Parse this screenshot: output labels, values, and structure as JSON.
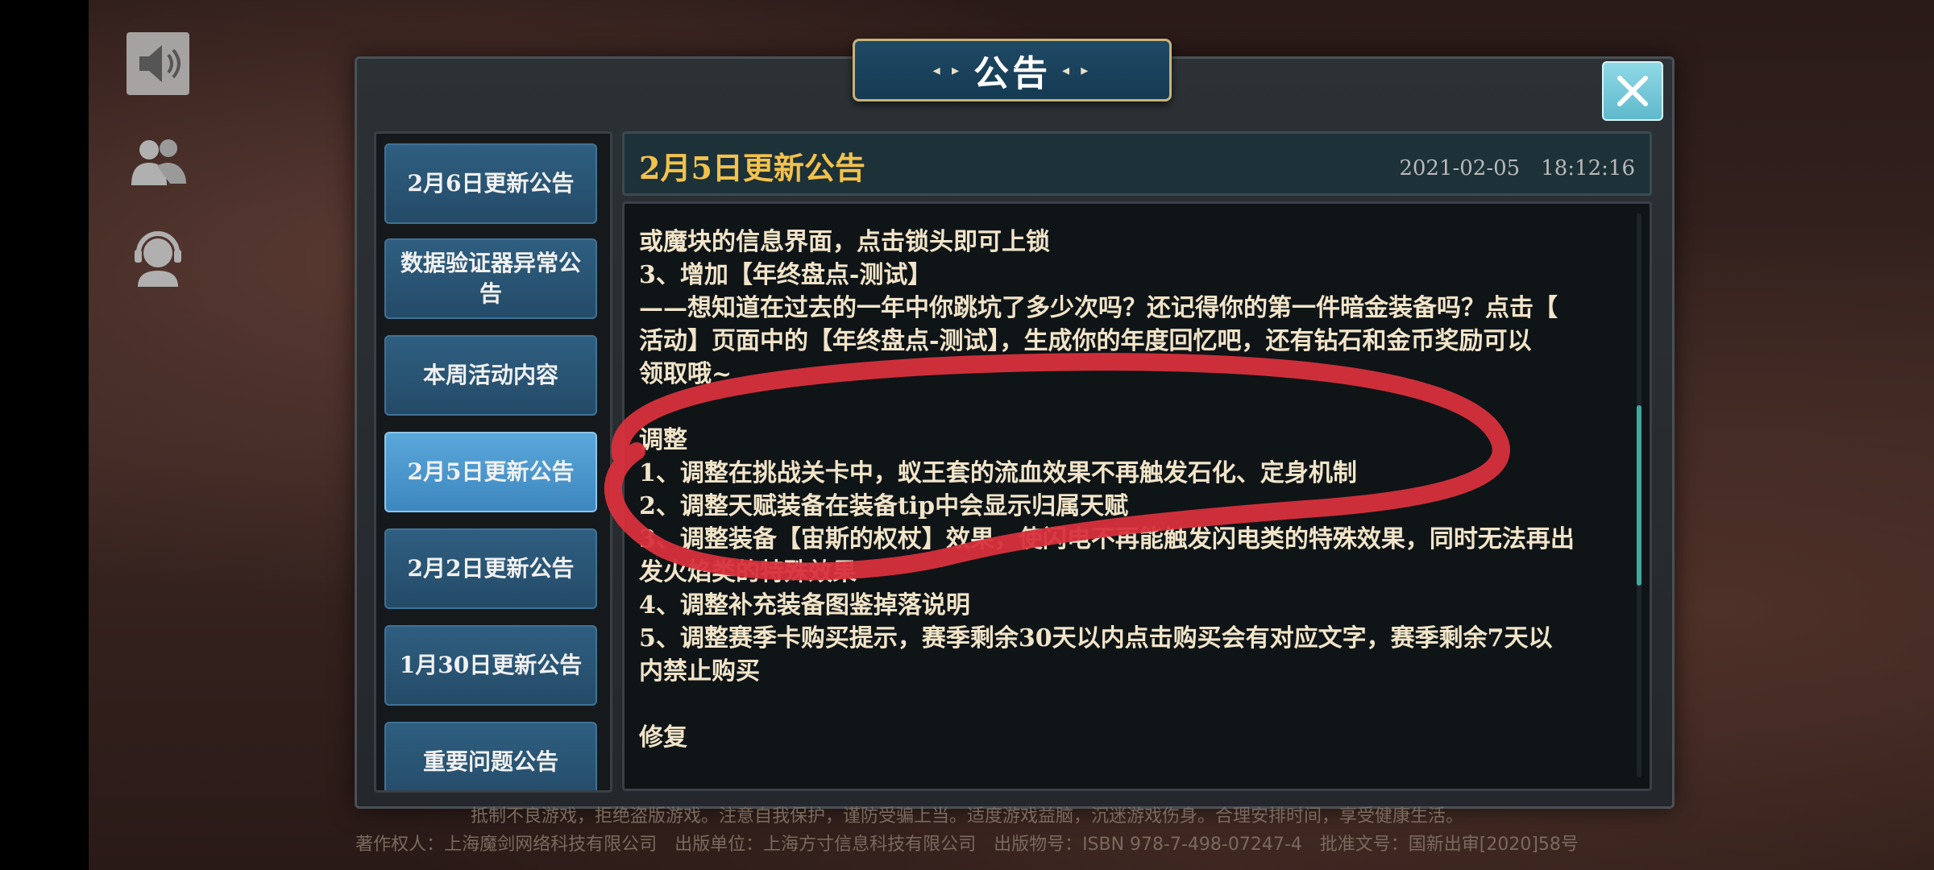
{
  "dialog": {
    "title": "公告",
    "close_label": "✕"
  },
  "tabs": [
    {
      "label": "2月6日更新公告"
    },
    {
      "label": "数据验证器异常公告"
    },
    {
      "label": "本周活动内容"
    },
    {
      "label": "2月5日更新公告"
    },
    {
      "label": "2月2日更新公告"
    },
    {
      "label": "1月30日更新公告"
    },
    {
      "label": "重要问题公告"
    }
  ],
  "header": {
    "title": "2月5日更新公告",
    "date": "2021-02-05　18:12:16"
  },
  "content": {
    "lines": [
      "或魔块的信息界面，点击锁头即可上锁",
      "3、增加【年终盘点-测试】",
      "——想知道在过去的一年中你跳坑了多少次吗？还记得你的第一件暗金装备吗？点击【",
      "活动】页面中的【年终盘点-测试】，生成你的年度回忆吧，还有钻石和金币奖励可以",
      "领取哦~",
      "",
      "调整",
      "1、调整在挑战关卡中，蚁王套的流血效果不再触发石化、定身机制",
      "2、调整天赋装备在装备tip中会显示归属天赋",
      "3、调整装备【宙斯的权杖】效果，使闪电不再能触发闪电类的特殊效果，同时无法再出",
      "发火焰类的特殊效果",
      "4、调整补充装备图鉴掉落说明",
      "5、调整赛季卡购买提示，赛季剩余30天以内点击购买会有对应文字，赛季剩余7天以",
      "内禁止购买",
      "",
      "修复"
    ]
  },
  "footer": {
    "line1": "抵制不良游戏，拒绝盗版游戏。注意自我保护，谨防受骗上当。适度游戏益脑，沉迷游戏伤身。合理安排时间，享受健康生活。",
    "line2": "著作权人：上海魔剑网络科技有限公司　出版单位：上海方寸信息科技有限公司　出版物号：ISBN 978-7-498-07247-4　批准文号：国新出审[2020]58号"
  },
  "colors": {
    "title_gold": "#f3c24c",
    "tab_active": "#5aa7da",
    "scroll_accent": "#3ea99d"
  }
}
